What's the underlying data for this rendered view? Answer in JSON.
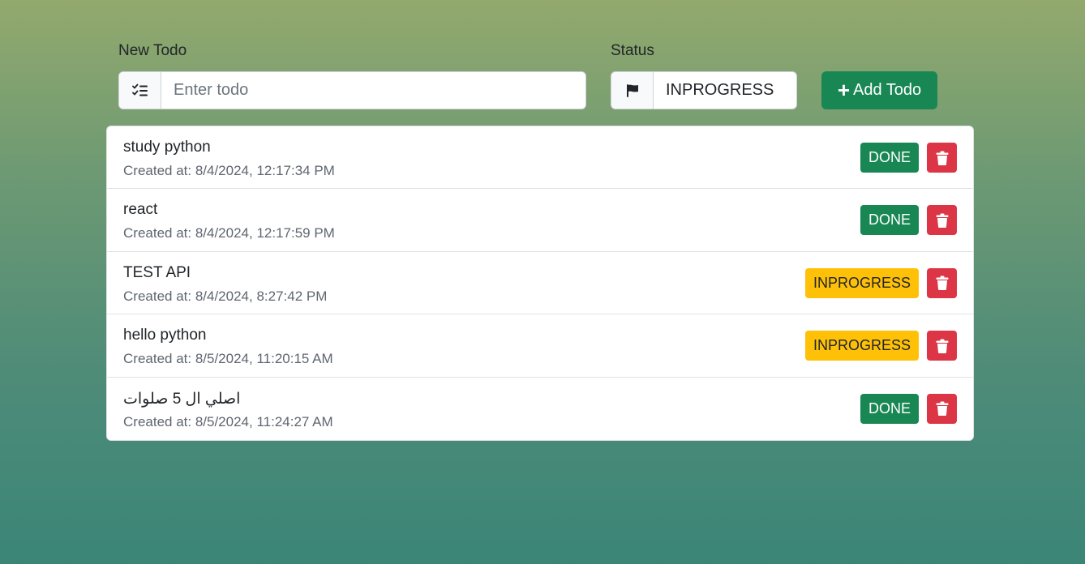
{
  "form": {
    "todo_label": "New Todo",
    "todo_placeholder": "Enter todo",
    "todo_value": "",
    "todo_icon": "checklist-icon",
    "status_label": "Status",
    "status_value": "INPROGRESS",
    "status_icon": "flag-icon",
    "add_button": "Add Todo",
    "add_icon": "plus-icon"
  },
  "colors": {
    "done": "#198754",
    "inprogress": "#ffc107",
    "delete": "#dc3545",
    "add": "#198754"
  },
  "todos": [
    {
      "title": "study python",
      "created": "Created at: 8/4/2024, 12:17:34 PM",
      "status": "DONE"
    },
    {
      "title": "react",
      "created": "Created at: 8/4/2024, 12:17:59 PM",
      "status": "DONE"
    },
    {
      "title": "TEST API",
      "created": "Created at: 8/4/2024, 8:27:42 PM",
      "status": "INPROGRESS"
    },
    {
      "title": "hello python",
      "created": "Created at: 8/5/2024, 11:20:15 AM",
      "status": "INPROGRESS"
    },
    {
      "title": "اصلي ال 5 صلوات",
      "created": "Created at: 8/5/2024, 11:24:27 AM",
      "status": "DONE"
    }
  ]
}
